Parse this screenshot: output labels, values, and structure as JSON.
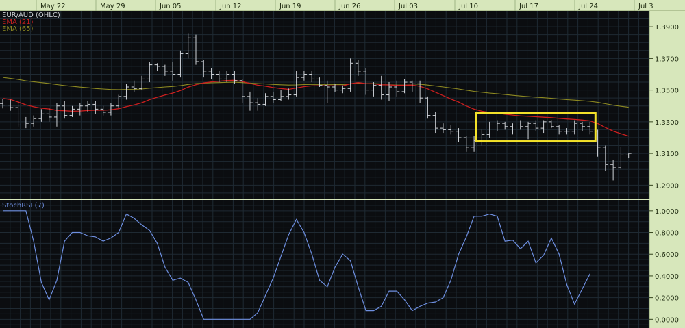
{
  "chart_data": [
    {
      "type": "ohlc",
      "title": "EUR/AUD (OHLC)",
      "x_ticks": [
        "May 22",
        "May 29",
        "Jun 05",
        "Jun 12",
        "Jun 19",
        "Jun 26",
        "Jul 03",
        "Jul 10",
        "Jul 17",
        "Jul 24",
        "Jul 3"
      ],
      "y_ticks": [
        "1.3900",
        "1.3700",
        "1.3500",
        "1.3300",
        "1.3100",
        "1.2900"
      ],
      "ylim": [
        1.2815,
        1.4
      ],
      "indicators": [
        {
          "name": "EMA (21)",
          "color": "#cc1f1f"
        },
        {
          "name": "EMA (65)",
          "color": "#8e8a22"
        }
      ],
      "ohlc": [
        [
          1.3415,
          1.3445,
          1.3385,
          1.3405
        ],
        [
          1.3405,
          1.344,
          1.337,
          1.339
        ],
        [
          1.339,
          1.343,
          1.327,
          1.328
        ],
        [
          1.328,
          1.333,
          1.326,
          1.329
        ],
        [
          1.329,
          1.334,
          1.327,
          1.332
        ],
        [
          1.332,
          1.338,
          1.33,
          1.335
        ],
        [
          1.335,
          1.339,
          1.33,
          1.333
        ],
        [
          1.333,
          1.342,
          1.327,
          1.34
        ],
        [
          1.34,
          1.343,
          1.332,
          1.334
        ],
        [
          1.334,
          1.34,
          1.333,
          1.338
        ],
        [
          1.338,
          1.342,
          1.334,
          1.34
        ],
        [
          1.34,
          1.343,
          1.336,
          1.341
        ],
        [
          1.341,
          1.343,
          1.335,
          1.338
        ],
        [
          1.338,
          1.34,
          1.334,
          1.336
        ],
        [
          1.336,
          1.342,
          1.334,
          1.34
        ],
        [
          1.34,
          1.347,
          1.339,
          1.346
        ],
        [
          1.346,
          1.354,
          1.344,
          1.352
        ],
        [
          1.352,
          1.356,
          1.349,
          1.351
        ],
        [
          1.351,
          1.359,
          1.35,
          1.357
        ],
        [
          1.357,
          1.368,
          1.355,
          1.366
        ],
        [
          1.366,
          1.367,
          1.362,
          1.365
        ],
        [
          1.365,
          1.366,
          1.359,
          1.362
        ],
        [
          1.362,
          1.368,
          1.356,
          1.36
        ],
        [
          1.36,
          1.375,
          1.358,
          1.373
        ],
        [
          1.373,
          1.386,
          1.37,
          1.383
        ],
        [
          1.383,
          1.385,
          1.366,
          1.368
        ],
        [
          1.368,
          1.369,
          1.358,
          1.362
        ],
        [
          1.362,
          1.364,
          1.357,
          1.36
        ],
        [
          1.36,
          1.362,
          1.355,
          1.357
        ],
        [
          1.357,
          1.362,
          1.355,
          1.36
        ],
        [
          1.36,
          1.362,
          1.354,
          1.356
        ],
        [
          1.356,
          1.357,
          1.342,
          1.346
        ],
        [
          1.346,
          1.349,
          1.337,
          1.342
        ],
        [
          1.342,
          1.345,
          1.337,
          1.341
        ],
        [
          1.341,
          1.348,
          1.34,
          1.346
        ],
        [
          1.346,
          1.349,
          1.342,
          1.344
        ],
        [
          1.344,
          1.35,
          1.343,
          1.346
        ],
        [
          1.346,
          1.351,
          1.344,
          1.347
        ],
        [
          1.347,
          1.362,
          1.346,
          1.358
        ],
        [
          1.358,
          1.362,
          1.356,
          1.36
        ],
        [
          1.36,
          1.362,
          1.355,
          1.357
        ],
        [
          1.357,
          1.358,
          1.352,
          1.353
        ],
        [
          1.353,
          1.356,
          1.342,
          1.352
        ],
        [
          1.352,
          1.354,
          1.349,
          1.35
        ],
        [
          1.35,
          1.353,
          1.348,
          1.351
        ],
        [
          1.351,
          1.37,
          1.349,
          1.367
        ],
        [
          1.367,
          1.369,
          1.359,
          1.362
        ],
        [
          1.362,
          1.364,
          1.347,
          1.35
        ],
        [
          1.35,
          1.355,
          1.346,
          1.353
        ],
        [
          1.353,
          1.359,
          1.344,
          1.347
        ],
        [
          1.347,
          1.355,
          1.343,
          1.352
        ],
        [
          1.352,
          1.356,
          1.346,
          1.349
        ],
        [
          1.349,
          1.357,
          1.348,
          1.355
        ],
        [
          1.355,
          1.356,
          1.349,
          1.354
        ],
        [
          1.354,
          1.356,
          1.342,
          1.345
        ],
        [
          1.345,
          1.346,
          1.332,
          1.334
        ],
        [
          1.334,
          1.336,
          1.323,
          1.326
        ],
        [
          1.326,
          1.329,
          1.323,
          1.325
        ],
        [
          1.325,
          1.328,
          1.322,
          1.324
        ],
        [
          1.324,
          1.326,
          1.317,
          1.32
        ],
        [
          1.32,
          1.321,
          1.311,
          1.314
        ],
        [
          1.314,
          1.321,
          1.311,
          1.318
        ],
        [
          1.318,
          1.325,
          1.315,
          1.322
        ],
        [
          1.322,
          1.33,
          1.32,
          1.328
        ],
        [
          1.328,
          1.331,
          1.324,
          1.329
        ],
        [
          1.329,
          1.33,
          1.325,
          1.327
        ],
        [
          1.327,
          1.329,
          1.322,
          1.328
        ],
        [
          1.328,
          1.331,
          1.325,
          1.327
        ],
        [
          1.327,
          1.33,
          1.319,
          1.329
        ],
        [
          1.329,
          1.331,
          1.324,
          1.326
        ],
        [
          1.326,
          1.331,
          1.323,
          1.33
        ],
        [
          1.33,
          1.331,
          1.326,
          1.327
        ],
        [
          1.327,
          1.328,
          1.322,
          1.324
        ],
        [
          1.324,
          1.326,
          1.322,
          1.324
        ],
        [
          1.324,
          1.331,
          1.322,
          1.329
        ],
        [
          1.329,
          1.33,
          1.324,
          1.327
        ],
        [
          1.327,
          1.33,
          1.322,
          1.324
        ],
        [
          1.324,
          1.325,
          1.308,
          1.314
        ],
        [
          1.314,
          1.315,
          1.299,
          1.303
        ],
        [
          1.303,
          1.306,
          1.293,
          1.301
        ],
        [
          1.301,
          1.314,
          1.3,
          1.309
        ],
        [
          1.309,
          1.31,
          1.307,
          1.31
        ]
      ],
      "ema21": [
        1.3448,
        1.3441,
        1.3425,
        1.3407,
        1.3395,
        1.3386,
        1.3381,
        1.3372,
        1.337,
        1.3367,
        1.3368,
        1.3371,
        1.3373,
        1.3373,
        1.3376,
        1.3383,
        1.3396,
        1.3406,
        1.342,
        1.344,
        1.3455,
        1.3469,
        1.3481,
        1.3497,
        1.3519,
        1.3534,
        1.3545,
        1.3552,
        1.3556,
        1.356,
        1.3562,
        1.3554,
        1.3542,
        1.3531,
        1.3525,
        1.3516,
        1.351,
        1.3505,
        1.3513,
        1.3522,
        1.3527,
        1.3528,
        1.3528,
        1.3527,
        1.3527,
        1.354,
        1.3547,
        1.3541,
        1.354,
        1.3534,
        1.3533,
        1.353,
        1.3531,
        1.3532,
        1.3524,
        1.3508,
        1.3486,
        1.3465,
        1.3444,
        1.3425,
        1.34,
        1.338,
        1.3367,
        1.3359,
        1.3354,
        1.3348,
        1.3342,
        1.3337,
        1.3335,
        1.3332,
        1.3329,
        1.3326,
        1.3322,
        1.3318,
        1.3315,
        1.3311,
        1.3306,
        1.3289,
        1.3264,
        1.3241,
        1.3225,
        1.321
      ],
      "ema65": [
        1.358,
        1.3574,
        1.3567,
        1.3559,
        1.3553,
        1.3547,
        1.3542,
        1.3535,
        1.3529,
        1.3524,
        1.3519,
        1.3515,
        1.351,
        1.3507,
        1.3504,
        1.3503,
        1.3504,
        1.3505,
        1.3507,
        1.3512,
        1.3516,
        1.352,
        1.3523,
        1.3528,
        1.3536,
        1.3541,
        1.3544,
        1.3546,
        1.3547,
        1.3549,
        1.355,
        1.3547,
        1.3544,
        1.3541,
        1.3539,
        1.3536,
        1.3534,
        1.3532,
        1.3533,
        1.3535,
        1.3536,
        1.3536,
        1.3536,
        1.3535,
        1.3535,
        1.3539,
        1.3542,
        1.3541,
        1.3541,
        1.3539,
        1.3539,
        1.3538,
        1.3539,
        1.3539,
        1.3537,
        1.3532,
        1.3526,
        1.352,
        1.3514,
        1.3507,
        1.3499,
        1.3492,
        1.3486,
        1.3481,
        1.3477,
        1.3472,
        1.3467,
        1.3463,
        1.3459,
        1.3455,
        1.3452,
        1.3448,
        1.3444,
        1.344,
        1.3437,
        1.3433,
        1.3429,
        1.3423,
        1.3414,
        1.3405,
        1.3398,
        1.3392
      ],
      "highlight": {
        "from_index": 62,
        "to_index": 76,
        "y_range": [
          1.3176,
          1.3356
        ],
        "color": "#f2e12a"
      }
    },
    {
      "type": "line",
      "title": "StochRSI (7)",
      "y_ticks": [
        "1.0000",
        "0.8000",
        "0.6000",
        "0.4000",
        "0.2000",
        "0.0000"
      ],
      "ylim": [
        -0.08,
        1.1
      ],
      "series": [
        {
          "name": "StochRSI (7)",
          "color": "#6e8fe0",
          "values": [
            1.0,
            1.0,
            1.0,
            1.0,
            0.72,
            0.34,
            0.18,
            0.36,
            0.72,
            0.8,
            0.8,
            0.77,
            0.76,
            0.72,
            0.75,
            0.8,
            0.97,
            0.93,
            0.87,
            0.82,
            0.7,
            0.48,
            0.36,
            0.38,
            0.34,
            0.18,
            0.0,
            0.0,
            0.0,
            0.0,
            0.0,
            0.0,
            0.0,
            0.06,
            0.22,
            0.38,
            0.58,
            0.78,
            0.92,
            0.8,
            0.6,
            0.36,
            0.3,
            0.48,
            0.6,
            0.54,
            0.3,
            0.08,
            0.08,
            0.12,
            0.26,
            0.26,
            0.18,
            0.08,
            0.12,
            0.15,
            0.16,
            0.2,
            0.36,
            0.6,
            0.76,
            0.95,
            0.95,
            0.97,
            0.95,
            0.72,
            0.73,
            0.65,
            0.72,
            0.52,
            0.59,
            0.75,
            0.6,
            0.32,
            0.14,
            0.28,
            0.42
          ]
        }
      ]
    }
  ]
}
